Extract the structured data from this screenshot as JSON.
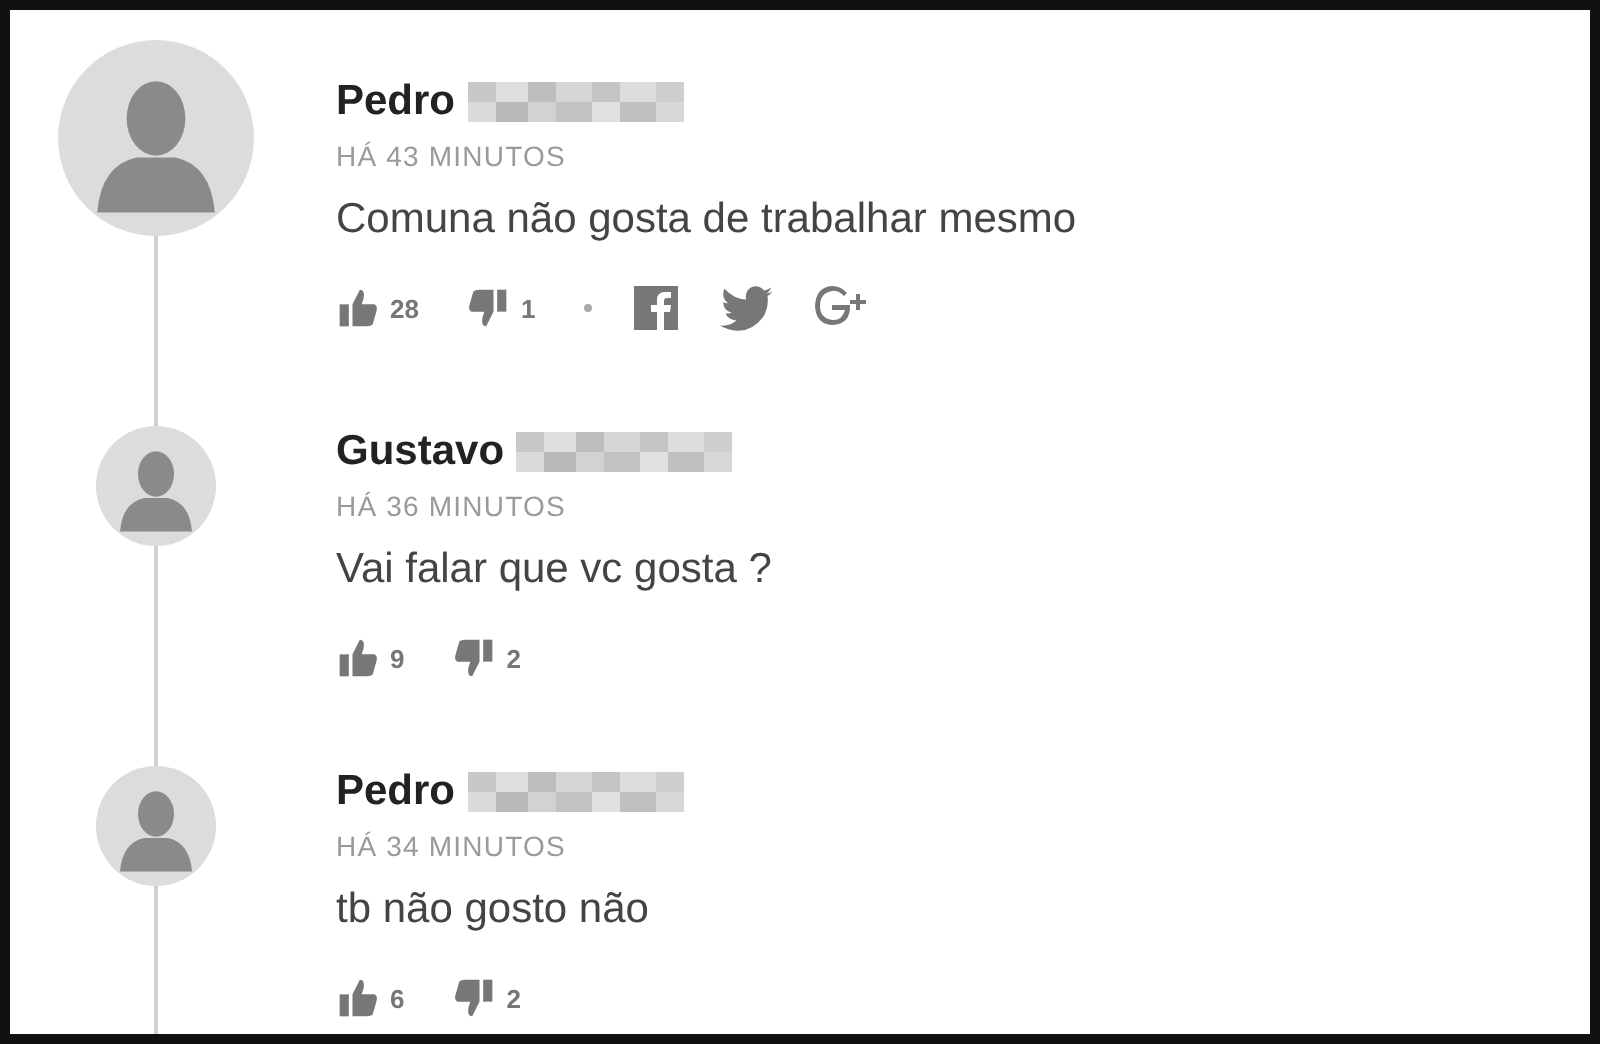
{
  "comments": [
    {
      "kind": "top",
      "author": "Pedro",
      "time": "HÁ 43 MINUTOS",
      "text": "Comuna não gosta de trabalhar mesmo",
      "likes": "28",
      "dislikes": "1",
      "share": true
    },
    {
      "kind": "reply",
      "author": "Gustavo",
      "time": "HÁ 36 MINUTOS",
      "text": "Vai falar que vc gosta ?",
      "likes": "9",
      "dislikes": "2",
      "share": false
    },
    {
      "kind": "reply",
      "author": "Pedro",
      "time": "HÁ 34 MINUTOS",
      "text": "tb não gosto não",
      "likes": "6",
      "dislikes": "2",
      "share": false
    }
  ]
}
